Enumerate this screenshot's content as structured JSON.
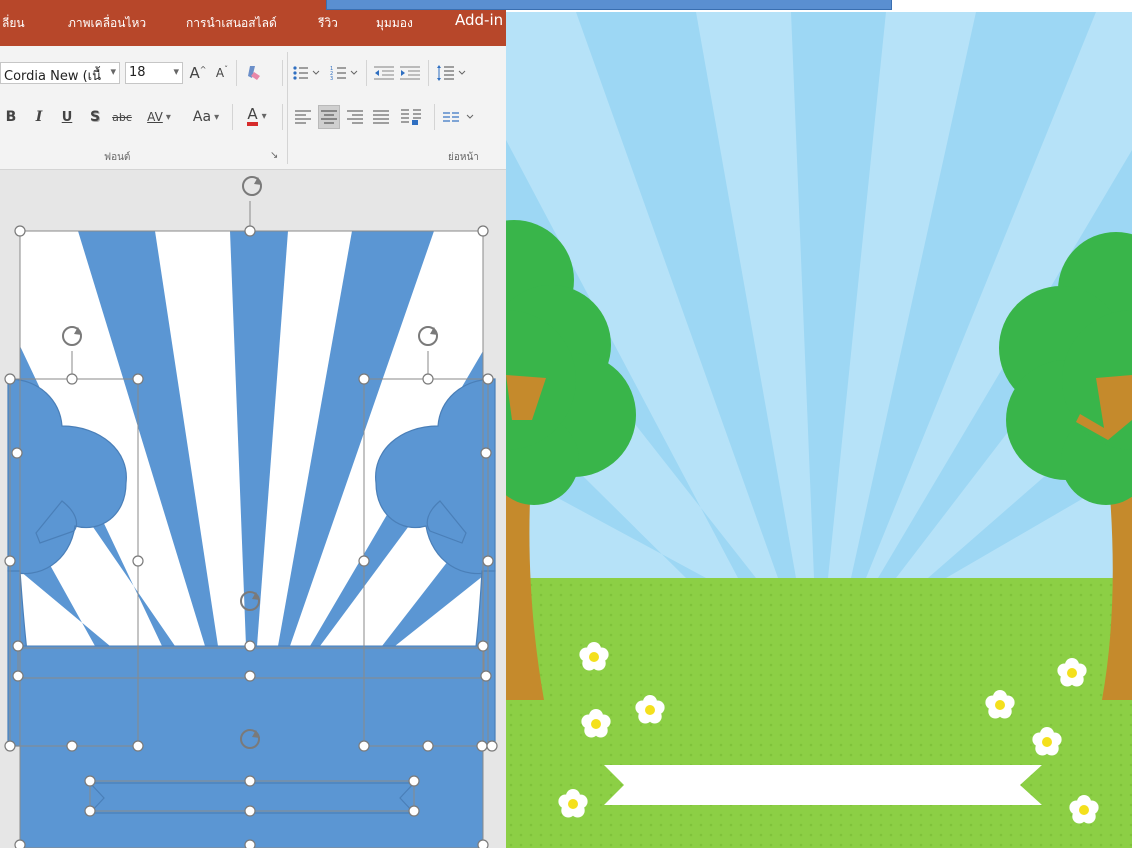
{
  "ribbon": {
    "tabs": [
      "ลี่ยน",
      "ภาพเคลื่อนไหว",
      "การนำเสนอสไลด์",
      "รีวิว",
      "มุมมอง",
      "Add-in"
    ],
    "font_name": "Cordia New (เนื้",
    "font_size": "18",
    "font_group_label": "ฟอนต์",
    "paragraph_group_label": "ย่อหน้า",
    "grow_font": "A",
    "shrink_font": "A",
    "bold": "B",
    "italic": "I",
    "underline": "U",
    "shadow": "S",
    "strikethrough": "abc",
    "char_spacing": "AV",
    "change_case": "Aa",
    "font_color": "A",
    "dropdown_arrow": "▾",
    "launcher": "↘"
  },
  "icons": [
    "clear-formatting-icon",
    "bullets-icon",
    "numbering-icon",
    "decrease-indent-icon",
    "increase-indent-icon",
    "line-spacing-icon",
    "align-left-icon",
    "align-center-icon",
    "align-right-icon",
    "justify-icon",
    "columns-icon",
    "text-direction-icon",
    "rotate-handle-icon",
    "flower-icon"
  ],
  "colors": {
    "tab_bar": "#b7472a",
    "shape_blue": "#5b96d3",
    "shape_outline": "#4a7fb8",
    "font_color_underline": "#d62b2b",
    "sky_light": "#b6e2f8",
    "sky_ray": "#9dd7f4",
    "grass": "#8ccf45",
    "grass_dot": "#7fc23a",
    "tree_green": "#39b54a",
    "trunk": "#c58a2c",
    "banner": "#ffffff",
    "flower_center": "#f4e01c"
  }
}
